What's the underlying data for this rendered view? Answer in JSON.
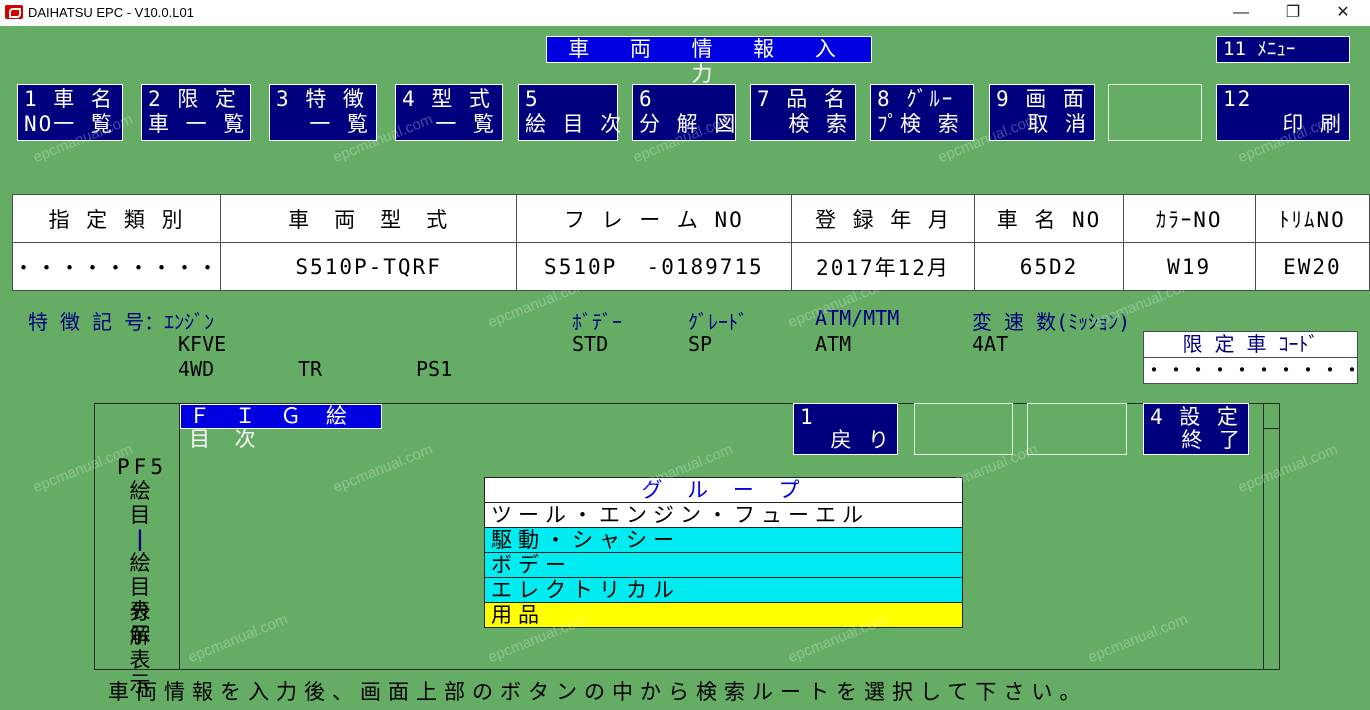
{
  "window": {
    "title": "DAIHATSU EPC - V10.0.L01",
    "minimize": "—",
    "maximize": "❐",
    "close": "✕"
  },
  "screen_title": "車 両 情 報 入 力",
  "menu_button": "11  ﾒﾆｭｰ",
  "func_buttons": [
    {
      "l1": "1 車 名",
      "l2": "NO一 覧"
    },
    {
      "l1": "2 限 定",
      "l2": "車 一 覧"
    },
    {
      "l1": "3 特 徴",
      "l2": "一 覧"
    },
    {
      "l1": "4 型 式",
      "l2": "一 覧"
    },
    {
      "l1": "5",
      "l2": "絵 目 次"
    },
    {
      "l1": "6",
      "l2": "分 解 図"
    },
    {
      "l1": "7 品 名",
      "l2": "検 索"
    },
    {
      "l1": "8 ｸﾞﾙｰ",
      "l2": "ﾌﾟ検 索"
    },
    {
      "l1": "9 画 面",
      "l2": "取 消"
    },
    {
      "l1": "12",
      "l2": "印 刷"
    }
  ],
  "vehicle_table": {
    "headers": [
      "指 定 類 別",
      "車　両　型　式",
      "フ レ ー ム NO",
      "登 録 年 月",
      "車 名 NO",
      "ｶﾗｰNO",
      "ﾄﾘﾑNO"
    ],
    "values": [
      "・・・・・・・・・",
      "S510P-TQRF",
      "S510P  -0189715",
      "2017年12月",
      "65D2",
      "W19",
      "EW20"
    ]
  },
  "features": {
    "label": "特 徴 記 号：ｴﾝｼﾞﾝ",
    "engine": "KFVE",
    "body_label": "ﾎﾞﾃﾞｰ",
    "body": "STD",
    "grade_label": "ｸﾞﾚｰﾄﾞ",
    "grade": "SP",
    "atm_label": "ATM/MTM",
    "atm": "ATM",
    "trans_label": "変 速 数(ﾐｯｼｮﾝ)",
    "trans": "4AT",
    "row2a": "4WD",
    "row2b": "TR",
    "row2c": "PS1"
  },
  "gentei": {
    "label": "限 定 車 ｺｰﾄﾞ",
    "value": "・・・・・・・・・・・"
  },
  "fig_title": "Ｆ Ｉ Ｇ 絵 目 次",
  "panel_buttons": [
    {
      "l1": "1",
      "l2": "戻 り"
    },
    {
      "l1": "4 設 定",
      "l2": "終 了"
    }
  ],
  "side_labels": {
    "pf5": "PF5",
    "e_moku": "絵 目",
    "bar": "|",
    "e_moku2": "絵 目",
    "hyoji": "表 示",
    "bunkai": "分 解",
    "hyoji2": "表 示"
  },
  "group_list": {
    "header": "グ ル ー プ",
    "items": [
      "ツール・エンジン・フューエル",
      "駆動・シャシー",
      "ボデー",
      "エレクトリカル",
      "用品"
    ]
  },
  "footer": "車両情報を入力後、画面上部のボタンの中から検索ルートを選択して下さい。",
  "watermark": "epcmanual.com"
}
